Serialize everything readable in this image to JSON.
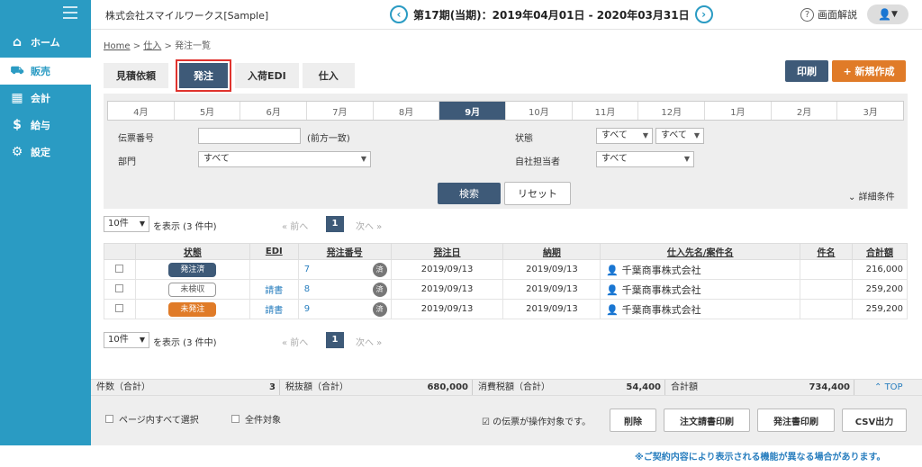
{
  "sidebar": {
    "items": [
      {
        "label": "ホーム",
        "icon": "home-icon",
        "glyph": "⌂"
      },
      {
        "label": "販売",
        "icon": "cart-icon",
        "glyph": "🛒"
      },
      {
        "label": "会計",
        "icon": "calculator-icon",
        "glyph": "▦"
      },
      {
        "label": "給与",
        "icon": "money-bag-icon",
        "glyph": "$"
      },
      {
        "label": "設定",
        "icon": "gear-icon",
        "glyph": "⚙"
      }
    ]
  },
  "header": {
    "company": "株式会社スマイルワークス[Sample]",
    "period": "第17期(当期)：2019年04月01日 - 2020年03月31日",
    "help": "画面解説"
  },
  "breadcrumb": {
    "home": "Home",
    "sep1": ">",
    "mid": "仕入",
    "sep2": ">",
    "current": "発注一覧"
  },
  "tabs": [
    "見積依頼",
    "発注",
    "入荷EDI",
    "仕入"
  ],
  "actions": {
    "print": "印刷",
    "new": "+ 新規作成"
  },
  "months": [
    "4月",
    "5月",
    "6月",
    "7月",
    "8月",
    "9月",
    "10月",
    "11月",
    "12月",
    "1月",
    "2月",
    "3月"
  ],
  "search": {
    "slip_label": "伝票番号",
    "slip_hint": "(前方一致)",
    "dept_label": "部門",
    "dept_value": "すべて",
    "status_label": "状態",
    "status_value1": "すべて",
    "status_value2": "すべて",
    "staff_label": "自社担当者",
    "staff_value": "すべて",
    "search_btn": "検索",
    "reset_btn": "リセット",
    "detail": "詳細条件"
  },
  "pager": {
    "per_page": "10件",
    "showing": "を表示 (3 件中)",
    "prev": "« 前へ",
    "page": "1",
    "next": "次へ »"
  },
  "table": {
    "headers": [
      "状態",
      "EDI",
      "発注番号",
      "発注日",
      "納期",
      "仕入先名/案件名",
      "件名",
      "合計額"
    ],
    "rows": [
      {
        "status": "発注済",
        "edi": "",
        "number": "7",
        "done": "済",
        "order_date": "2019/09/13",
        "due": "2019/09/13",
        "supplier": "千葉商事株式会社",
        "subject": "",
        "total": "216,000"
      },
      {
        "status": "未検収",
        "edi": "請書",
        "number": "8",
        "done": "済",
        "order_date": "2019/09/13",
        "due": "2019/09/13",
        "supplier": "千葉商事株式会社",
        "subject": "",
        "total": "259,200"
      },
      {
        "status": "未発注",
        "edi": "請書",
        "number": "9",
        "done": "済",
        "order_date": "2019/09/13",
        "due": "2019/09/13",
        "supplier": "千葉商事株式会社",
        "subject": "",
        "total": "259,200"
      }
    ]
  },
  "summary": {
    "count_label": "件数（合計）",
    "count": "3",
    "pretax_label": "税抜額（合計）",
    "pretax": "680,000",
    "tax_label": "消費税額（合計）",
    "tax": "54,400",
    "total_label": "合計額",
    "total": "734,400",
    "top": "TOP"
  },
  "footer": {
    "select_page": "ページ内すべて選択",
    "select_all": "全件対象",
    "target_note": "の伝票が操作対象です。",
    "delete": "削除",
    "po_print": "注文請書印刷",
    "order_print": "発注書印刷",
    "csv": "CSV出力"
  },
  "contract_note": "※ご契約内容により表示される機能が異なる場合があります。"
}
